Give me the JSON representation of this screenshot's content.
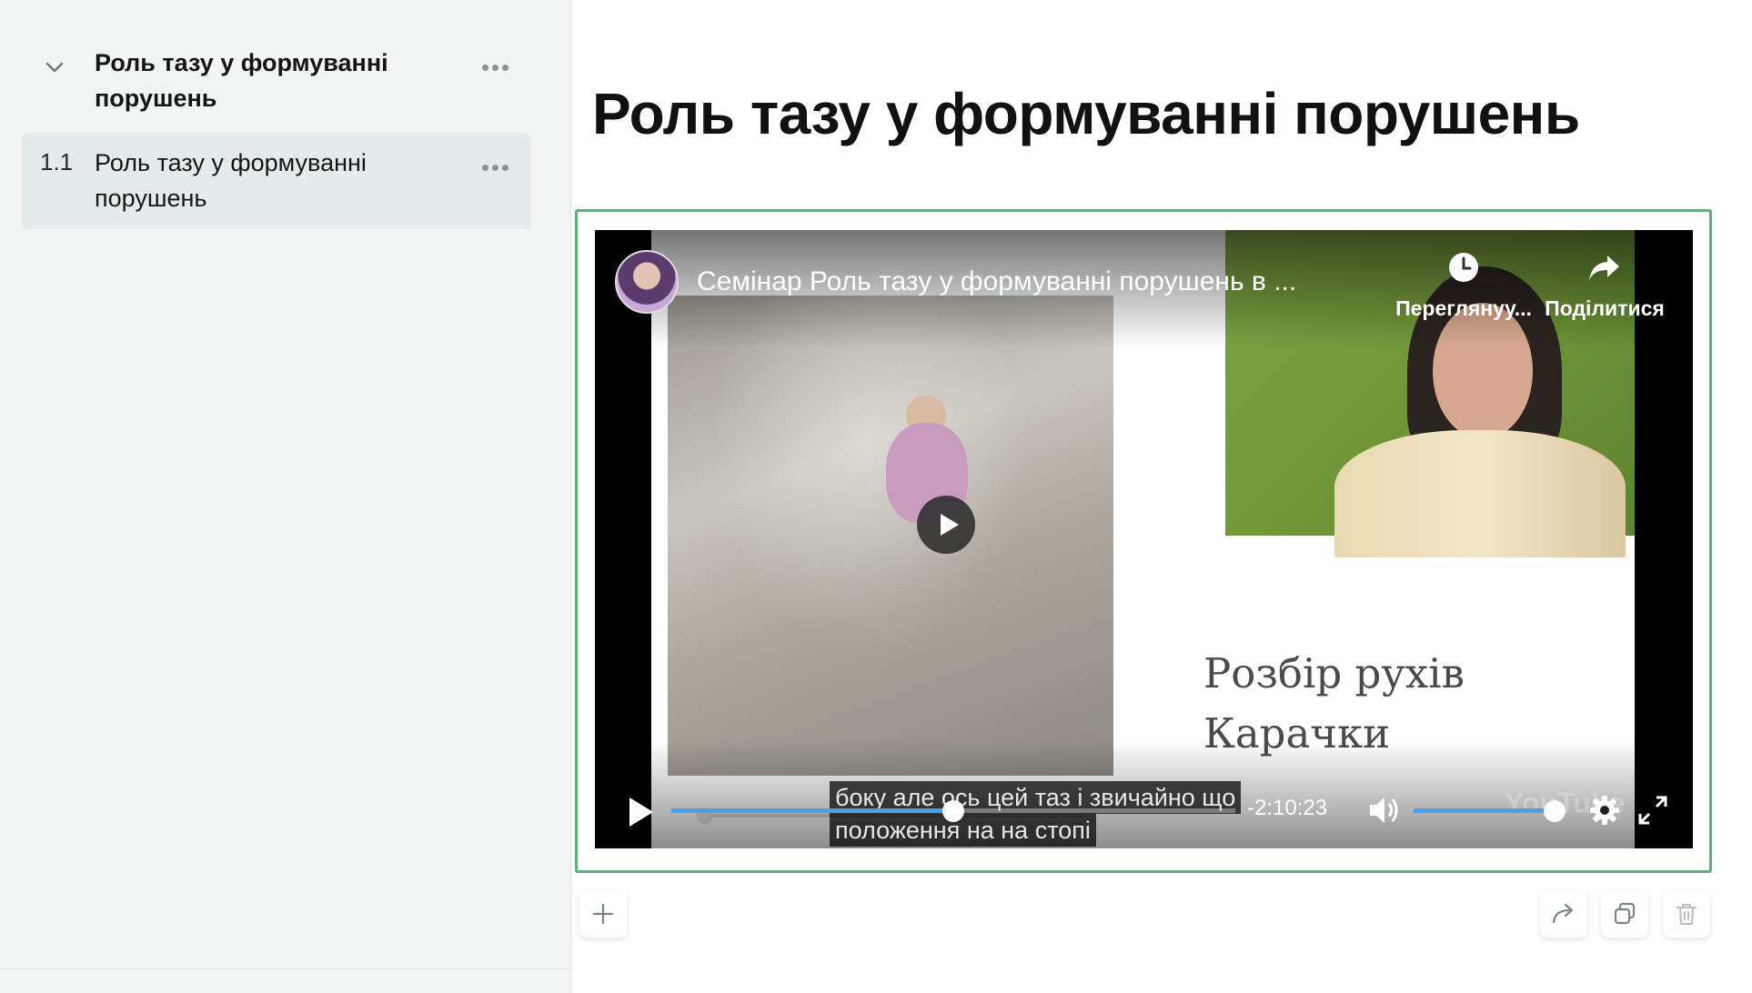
{
  "sidebar": {
    "section": {
      "title": "Роль тазу у формуванні порушень"
    },
    "items": [
      {
        "number": "1.1",
        "title": "Роль тазу у формуванні порушень"
      }
    ]
  },
  "page": {
    "title": "Роль тазу у формуванні порушень"
  },
  "video": {
    "title": "Семінар Роль тазу у формуванні порушень в ...",
    "watch_later_label": "Переглянуу...",
    "share_label": "Поділитися",
    "slide_text_line1": "Розбір рухів",
    "slide_text_line2": "Карачки",
    "subtitle_line1": "боку але ось цей таз і звичайно що",
    "subtitle_line2": "положення на на стопі",
    "time_remaining": "-2:10:23",
    "progress": 0.5,
    "volume": 1.0,
    "logo": "YouTube"
  },
  "toolbar": {
    "icons": [
      "plus-icon",
      "share-arrow-icon",
      "duplicate-icon",
      "trash-icon"
    ]
  },
  "colors": {
    "accent_border": "#5fb07a",
    "progress_fill": "#4aa0e8",
    "sidebar_bg": "#f3f5f4",
    "selected_item_bg": "#e5eaea"
  }
}
